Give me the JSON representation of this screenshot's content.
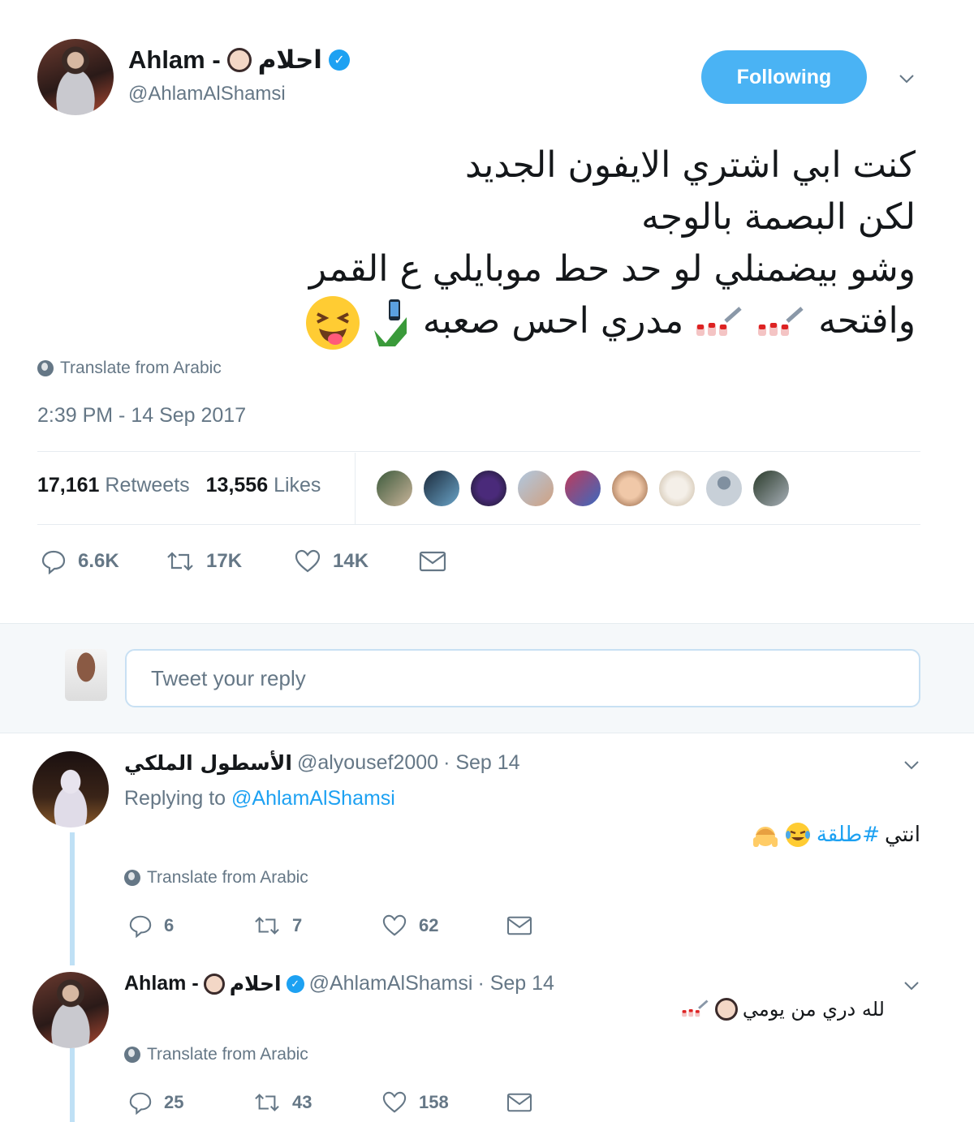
{
  "main_tweet": {
    "display_name_en": "Ahlam -",
    "display_name_ar": "احلام",
    "handle": "@AhlamAlShamsi",
    "follow_label": "Following",
    "text_lines": [
      "كنت ابي اشتري الايفون الجديد",
      "لكن البصمة بالوجه",
      "وشو بيضمنلي لو حد حط موبايلي ع القمر",
      "وافتحه",
      "مدري احس صعبه"
    ],
    "translate_label": "Translate from Arabic",
    "timestamp": "2:39 PM - 14 Sep 2017",
    "retweets_count": "17,161",
    "retweets_label": "Retweets",
    "likes_count": "13,556",
    "likes_label": "Likes",
    "action_counts": {
      "reply": "6.6K",
      "retweet": "17K",
      "like": "14K"
    }
  },
  "reply_box": {
    "placeholder": "Tweet your reply"
  },
  "replies": [
    {
      "display_name": "الأسطول الملكي",
      "handle": "@alyousef2000",
      "date": "· Sep 14",
      "replying_label": "Replying to",
      "replying_mention": "@AhlamAlShamsi",
      "text": "انتي",
      "hashtag": "#طلقة",
      "translate_label": "Translate from Arabic",
      "counts": {
        "reply": "6",
        "retweet": "7",
        "like": "62"
      }
    },
    {
      "display_name_en": "Ahlam -",
      "display_name_ar": "احلام",
      "handle": "@AhlamAlShamsi",
      "date": "· Sep 14",
      "text": "لله دري من يومي",
      "translate_label": "Translate from Arabic",
      "counts": {
        "reply": "25",
        "retweet": "43",
        "like": "158"
      }
    }
  ],
  "colors": {
    "accent": "#1da1f2",
    "follow_button": "#4ab3f4",
    "muted": "#657786",
    "thread_line": "#bfe0f5"
  },
  "icons": [
    "verified-icon",
    "chevron-down-icon",
    "globe-icon",
    "reply-icon",
    "retweet-icon",
    "like-icon",
    "message-icon",
    "nail-polish-emoji",
    "phone-emoji",
    "laughing-emoji",
    "woman-emoji"
  ]
}
